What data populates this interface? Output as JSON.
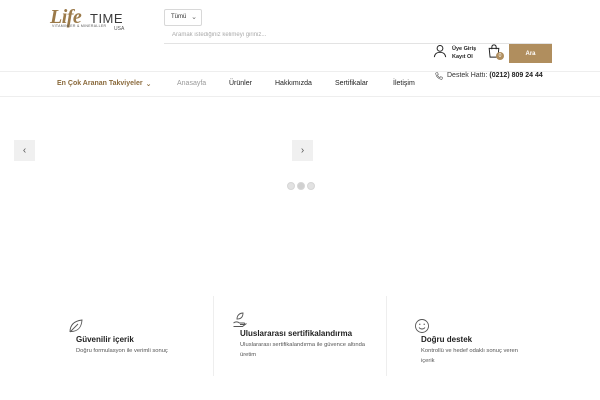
{
  "header": {
    "logo": {
      "brand_script": "Life",
      "brand_time": "TIME",
      "tagline": "VITAMINLER & MINERALLER",
      "country": "USA"
    },
    "category_select": {
      "selected": "Tümü"
    },
    "search": {
      "placeholder": "Aramak istediğiniz kelimeyi giriniz..."
    },
    "user": {
      "line1": "Üye Giriş",
      "line2": "Kayıt Ol"
    },
    "cart": {
      "count": "0"
    },
    "search_button": "Ara"
  },
  "nav": {
    "category_menu": "En Çok Aranan Takviyeler",
    "items": [
      {
        "label": "Anasayfa"
      },
      {
        "label": "Ürünler"
      },
      {
        "label": "Hakkımızda"
      },
      {
        "label": "Sertifikalar"
      },
      {
        "label": "İletişim"
      }
    ],
    "support": {
      "label": "Destek Hattı:",
      "phone": "(0212) 809 24 44"
    }
  },
  "slider": {
    "active_dot": 1
  },
  "features": [
    {
      "title": "Güvenilir içerik",
      "desc": "Doğru formulasyon ile verimli sonuç",
      "icon": "leaf-icon"
    },
    {
      "title": "Uluslararası sertifikalandırma",
      "desc": "Uluslararası sertifikalandırma ile güvence altında üretim",
      "icon": "hand-leaf-icon"
    },
    {
      "title": "Doğru destek",
      "desc": "Kontrollü ve hedef odaklı sonuç veren içerik",
      "icon": "smile-icon"
    }
  ],
  "colors": {
    "accent": "#b08e5e",
    "accent_dark": "#8a6a3c"
  }
}
